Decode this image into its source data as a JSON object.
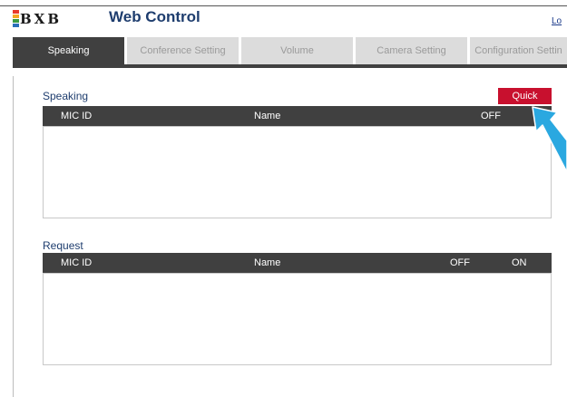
{
  "header": {
    "logo_text": "BXB",
    "logo_colors": [
      "#e8392c",
      "#f5a623",
      "#3a9b42",
      "#2a6fb8"
    ],
    "title": "Web Control",
    "logout_label": "Lo"
  },
  "tabs": [
    {
      "label": "Speaking",
      "active": true
    },
    {
      "label": "Conference Setting",
      "active": false
    },
    {
      "label": "Volume",
      "active": false
    },
    {
      "label": "Camera Setting",
      "active": false
    },
    {
      "label": "Configuration Settin",
      "active": false
    }
  ],
  "speaking": {
    "title": "Speaking",
    "quick_label": "Quick",
    "columns": [
      "MIC ID",
      "Name",
      "OFF"
    ],
    "rows": []
  },
  "request": {
    "title": "Request",
    "columns": [
      "MIC ID",
      "Name",
      "OFF",
      "ON"
    ],
    "rows": []
  },
  "colors": {
    "accent_red": "#c8102e",
    "header_dark": "#404040",
    "title_blue": "#1e3d6e",
    "pointer_cyan": "#2aa8e0"
  }
}
